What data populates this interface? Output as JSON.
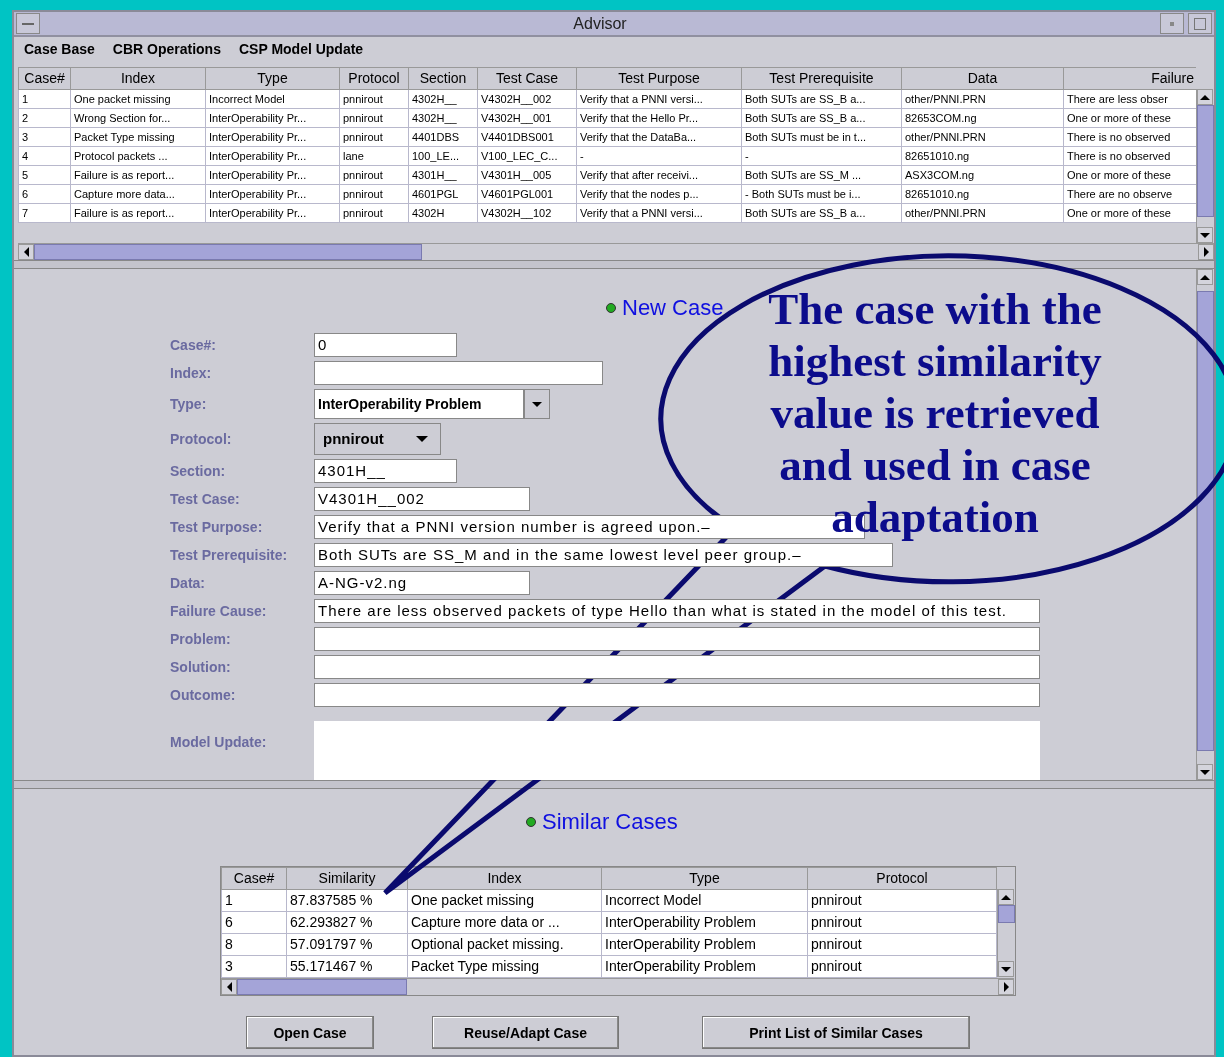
{
  "window": {
    "title": "Advisor"
  },
  "menu": [
    "Case Base",
    "CBR Operations",
    "CSP Model Update"
  ],
  "case_table": {
    "columns": [
      "Case#",
      "Index",
      "Type",
      "Protocol",
      "Section",
      "Test Case",
      "Test Purpose",
      "Test Prerequisite",
      "Data",
      "Failure"
    ],
    "rows": [
      [
        "1",
        "One packet missing",
        "Incorrect Model",
        "pnnirout",
        "4302H__",
        "V4302H__002",
        "Verify that a PNNI versi...",
        "Both SUTs are SS_B a...",
        "other/PNNI.PRN",
        "There are less obser"
      ],
      [
        "2",
        "Wrong Section for...",
        "InterOperability Pr...",
        "pnnirout",
        "4302H__",
        "V4302H__001",
        "Verify that the Hello Pr...",
        "Both SUTs are SS_B a...",
        "82653COM.ng",
        "One or more of these"
      ],
      [
        "3",
        "Packet Type missing",
        "InterOperability Pr...",
        "pnnirout",
        "4401DBS",
        "V4401DBS001",
        "Verify that the DataBa...",
        "Both SUTs must be in t...",
        "other/PNNI.PRN",
        "There is no observed"
      ],
      [
        "4",
        "Protocol packets ...",
        "InterOperability Pr...",
        "lane",
        "100_LE...",
        "V100_LEC_C...",
        "-",
        "-",
        "82651010.ng",
        "There is no observed"
      ],
      [
        "5",
        "Failure is as report...",
        "InterOperability Pr...",
        "pnnirout",
        "4301H__",
        "V4301H__005",
        "Verify that after receivi...",
        "Both SUTs are SS_M ...",
        "ASX3COM.ng",
        "One or more of these"
      ],
      [
        "6",
        "Capture more data...",
        "InterOperability Pr...",
        "pnnirout",
        "4601PGL",
        "V4601PGL001",
        "Verify that the nodes p...",
        "- Both SUTs must be i...",
        "82651010.ng",
        "There are no observe"
      ],
      [
        "7",
        "Failure is as report...",
        "InterOperability Pr...",
        "pnnirout",
        "4302H",
        "V4302H__102",
        "Verify that a PNNI versi...",
        "Both SUTs are SS_B a...",
        "other/PNNI.PRN",
        "One or more of these"
      ]
    ]
  },
  "new_case": {
    "heading": "New Case",
    "fields": [
      {
        "label": "Case#:",
        "kind": "text",
        "value": "0"
      },
      {
        "label": "Index:",
        "kind": "text"
      },
      {
        "label": "Type:",
        "kind": "editable-combo",
        "value": "InterOperability Problem"
      },
      {
        "label": "Protocol:",
        "kind": "combo",
        "value": "pnnirout"
      },
      {
        "label": "Section:",
        "kind": "text",
        "value": "4301H__"
      },
      {
        "label": "Test Case:",
        "kind": "text",
        "value": "V4301H__002"
      },
      {
        "label": "Test Purpose:",
        "kind": "text",
        "value": "Verify that a PNNI version number is agreed upon.–"
      },
      {
        "label": "Test Prerequisite:",
        "kind": "text",
        "value": "Both SUTs are SS_M and in the same lowest level peer group.–"
      },
      {
        "label": "Data:",
        "kind": "text",
        "value": "A-NG-v2.ng"
      },
      {
        "label": "Failure Cause:",
        "kind": "text",
        "value": "There are less observed packets of type Hello than what is stated in the model of this test."
      },
      {
        "label": "Problem:",
        "kind": "text"
      },
      {
        "label": "Solution:",
        "kind": "text"
      },
      {
        "label": "Outcome:",
        "kind": "text"
      },
      {
        "label": "Model Update:",
        "kind": "textarea"
      }
    ]
  },
  "similar_cases": {
    "heading": "Similar Cases",
    "columns": [
      "Case#",
      "Similarity",
      "Index",
      "Type",
      "Protocol"
    ],
    "rows": [
      [
        "1",
        "87.837585 %",
        "One packet missing",
        "Incorrect Model",
        "pnnirout"
      ],
      [
        "6",
        "62.293827 %",
        "Capture more data or ...",
        "InterOperability Problem",
        "pnnirout"
      ],
      [
        "8",
        "57.091797 %",
        "Optional packet missing.",
        "InterOperability Problem",
        "pnnirout"
      ],
      [
        "3",
        "55.171467 %",
        "Packet Type missing",
        "InterOperability Problem",
        "pnnirout"
      ]
    ]
  },
  "buttons": [
    "Open Case",
    "Reuse/Adapt Case",
    "Print List of Similar Cases"
  ],
  "callout": {
    "text": "The case with the highest similarity value is retrieved and used in case adaptation"
  }
}
